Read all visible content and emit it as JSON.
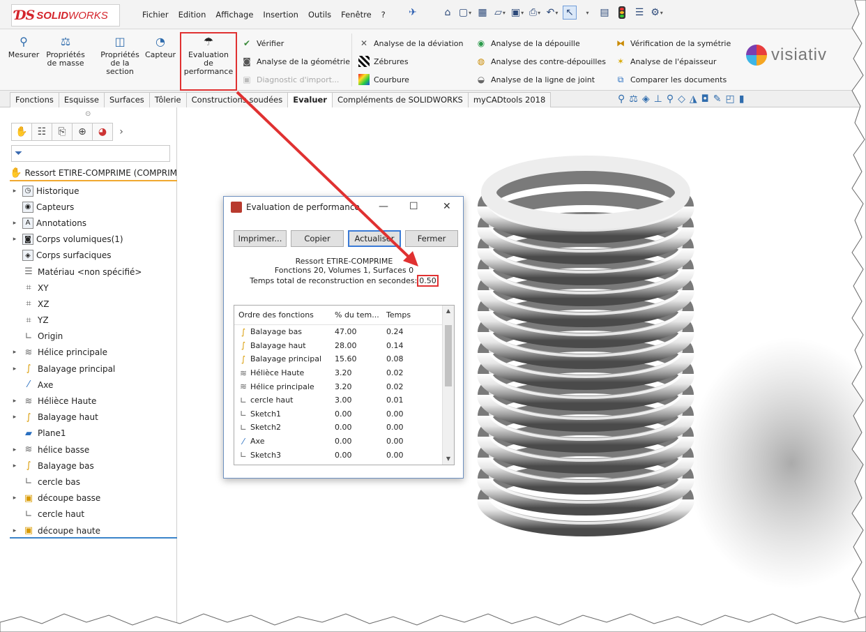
{
  "app": {
    "logo_ds": "ƊS",
    "logo_solid": "SOLID",
    "logo_works": "WORKS",
    "menu": [
      "Fichier",
      "Edition",
      "Affichage",
      "Insertion",
      "Outils",
      "Fenêtre",
      "?"
    ]
  },
  "ribbon": {
    "mesurer": "Mesurer",
    "proprietes_masse": [
      "Propriétés",
      "de masse"
    ],
    "proprietes_section": [
      "Propriétés",
      "de la",
      "section"
    ],
    "capteur": "Capteur",
    "evaluation": [
      "Evaluation",
      "de",
      "performance"
    ],
    "verifier": "Vérifier",
    "analyse_geometrie": "Analyse de la géométrie",
    "diagnostic_import": "Diagnostic d'import...",
    "analyse_deviation": "Analyse de la déviation",
    "zebrures": "Zébrures",
    "courbure": "Courbure",
    "analyse_depouille": "Analyse de la dépouille",
    "analyse_contre_depouilles": "Analyse des contre-dépouilles",
    "analyse_ligne_joint": "Analyse de la ligne de joint",
    "verification_symetrie": "Vérification de la symétrie",
    "analyse_epaisseur": "Analyse de l'épaisseur",
    "comparer_documents": "Comparer les documents",
    "visiativ": "visiativ"
  },
  "tabs": [
    "Fonctions",
    "Esquisse",
    "Surfaces",
    "Tôlerie",
    "Constructions soudées",
    "Evaluer",
    "Compléments de SOLIDWORKS",
    "myCADtools 2018"
  ],
  "active_tab": "Evaluer",
  "tree": {
    "root": "Ressort ETIRE-COMPRIME  (COMPRIM",
    "items": [
      {
        "label": "Historique",
        "exp": true,
        "icon": "history-icon"
      },
      {
        "label": "Capteurs",
        "exp": false,
        "icon": "sensor-icon"
      },
      {
        "label": "Annotations",
        "exp": true,
        "icon": "annotation-icon"
      },
      {
        "label": "Corps volumiques(1)",
        "exp": true,
        "icon": "solid-body-icon"
      },
      {
        "label": "Corps surfaciques",
        "exp": false,
        "icon": "surface-body-icon"
      },
      {
        "label": "Matériau <non spécifié>",
        "exp": false,
        "icon": "material-icon"
      },
      {
        "label": "XY",
        "exp": false,
        "icon": "plane-icon"
      },
      {
        "label": "XZ",
        "exp": false,
        "icon": "plane-icon"
      },
      {
        "label": "YZ",
        "exp": false,
        "icon": "plane-icon"
      },
      {
        "label": "Origin",
        "exp": false,
        "icon": "origin-icon"
      },
      {
        "label": "Hélice principale",
        "exp": true,
        "icon": "helix-icon"
      },
      {
        "label": "Balayage principal",
        "exp": true,
        "icon": "sweep-icon"
      },
      {
        "label": "Axe",
        "exp": false,
        "icon": "axis-icon"
      },
      {
        "label": "Hélièce Haute",
        "exp": true,
        "icon": "helix-icon"
      },
      {
        "label": "Balayage haut",
        "exp": true,
        "icon": "sweep-icon"
      },
      {
        "label": "Plane1",
        "exp": false,
        "icon": "plane-solid-icon"
      },
      {
        "label": "hélice basse",
        "exp": true,
        "icon": "helix-icon"
      },
      {
        "label": "Balayage bas",
        "exp": true,
        "icon": "sweep-icon"
      },
      {
        "label": "cercle bas",
        "exp": false,
        "icon": "sketch-icon"
      },
      {
        "label": "découpe basse",
        "exp": true,
        "icon": "cut-icon"
      },
      {
        "label": "cercle haut",
        "exp": false,
        "icon": "sketch-icon"
      },
      {
        "label": "découpe haute",
        "exp": true,
        "icon": "cut-icon"
      }
    ]
  },
  "dialog": {
    "title": "Evaluation de performance",
    "buttons": {
      "imprimer": "Imprimer...",
      "copier": "Copier",
      "actualiser": "Actualiser",
      "fermer": "Fermer"
    },
    "part_name": "Ressort ETIRE-COMPRIME",
    "summary": "Fonctions 20, Volumes 1, Surfaces 0",
    "total_label": "Temps total de reconstruction en secondes:",
    "total_value": "0.50",
    "columns": [
      "Ordre des fonctions",
      "% du tem...",
      "Temps"
    ],
    "rows": [
      {
        "name": "Balayage bas",
        "pct": "47.00",
        "time": "0.24",
        "icon": "sweep-icon"
      },
      {
        "name": "Balayage haut",
        "pct": "28.00",
        "time": "0.14",
        "icon": "sweep-icon"
      },
      {
        "name": "Balayage principal",
        "pct": "15.60",
        "time": "0.08",
        "icon": "sweep-icon"
      },
      {
        "name": "Hélièce Haute",
        "pct": "3.20",
        "time": "0.02",
        "icon": "helix-icon"
      },
      {
        "name": "Hélice principale",
        "pct": "3.20",
        "time": "0.02",
        "icon": "helix-icon"
      },
      {
        "name": "cercle haut",
        "pct": "3.00",
        "time": "0.01",
        "icon": "sketch-icon"
      },
      {
        "name": "Sketch1",
        "pct": "0.00",
        "time": "0.00",
        "icon": "sketch-icon"
      },
      {
        "name": "Sketch2",
        "pct": "0.00",
        "time": "0.00",
        "icon": "sketch-icon"
      },
      {
        "name": "Axe",
        "pct": "0.00",
        "time": "0.00",
        "icon": "axis-icon"
      },
      {
        "name": "Sketch3",
        "pct": "0.00",
        "time": "0.00",
        "icon": "sketch-icon"
      }
    ]
  },
  "colors": {
    "accent_red": "#e03131",
    "solidworks_red": "#d4242b",
    "selection_blue": "#3a84c9",
    "tree_root_orange": "#f0a830"
  }
}
